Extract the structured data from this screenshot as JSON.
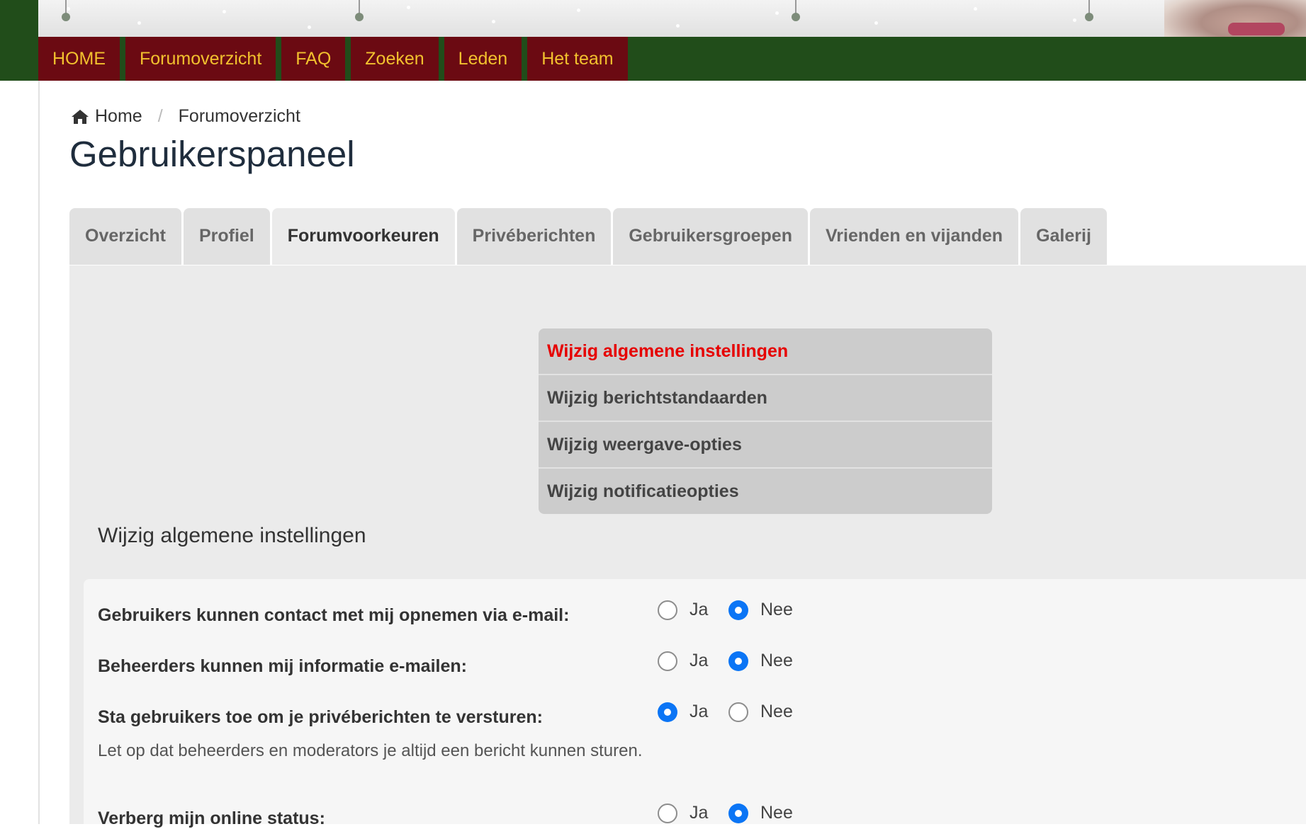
{
  "nav": {
    "items": [
      "HOME",
      "Forumoverzicht",
      "FAQ",
      "Zoeken",
      "Leden",
      "Het team"
    ]
  },
  "breadcrumb": {
    "home": "Home",
    "separator": "/",
    "current": "Forumoverzicht"
  },
  "page": {
    "title": "Gebruikerspaneel"
  },
  "tabs": [
    {
      "label": "Overzicht"
    },
    {
      "label": "Profiel"
    },
    {
      "label": "Forumvoorkeuren",
      "active": true
    },
    {
      "label": "Privéberichten"
    },
    {
      "label": "Gebruikersgroepen"
    },
    {
      "label": "Vrienden en vijanden"
    },
    {
      "label": "Galerij"
    }
  ],
  "submenu": {
    "items": [
      {
        "label": "Wijzig algemene instellingen",
        "active": true
      },
      {
        "label": "Wijzig berichtstandaarden"
      },
      {
        "label": "Wijzig weergave-opties"
      },
      {
        "label": "Wijzig notificatieopties"
      }
    ]
  },
  "section": {
    "title": "Wijzig algemene instellingen"
  },
  "settings": [
    {
      "label": "Gebruikers kunnen contact met mij opnemen via e-mail:",
      "yes": "Ja",
      "no": "Nee",
      "selected": "Nee"
    },
    {
      "label": "Beheerders kunnen mij informatie e-mailen:",
      "yes": "Ja",
      "no": "Nee",
      "selected": "Nee"
    },
    {
      "label": "Sta gebruikers toe om je privéberichten te versturen:",
      "hint": "Let op dat beheerders en moderators je altijd een bericht kunnen sturen.",
      "yes": "Ja",
      "no": "Nee",
      "selected": "Ja"
    },
    {
      "label": "Verberg mijn online status:",
      "yes": "Ja",
      "no": "Nee",
      "selected": "Nee"
    }
  ],
  "colors": {
    "nav_bg": "#214d1a",
    "nav_item_bg": "#6b0a12",
    "nav_item_text": "#f2c12e",
    "submenu_active": "#e60000",
    "radio_checked": "#0b75f5"
  },
  "icons": {
    "breadcrumb_home": "home-icon"
  }
}
